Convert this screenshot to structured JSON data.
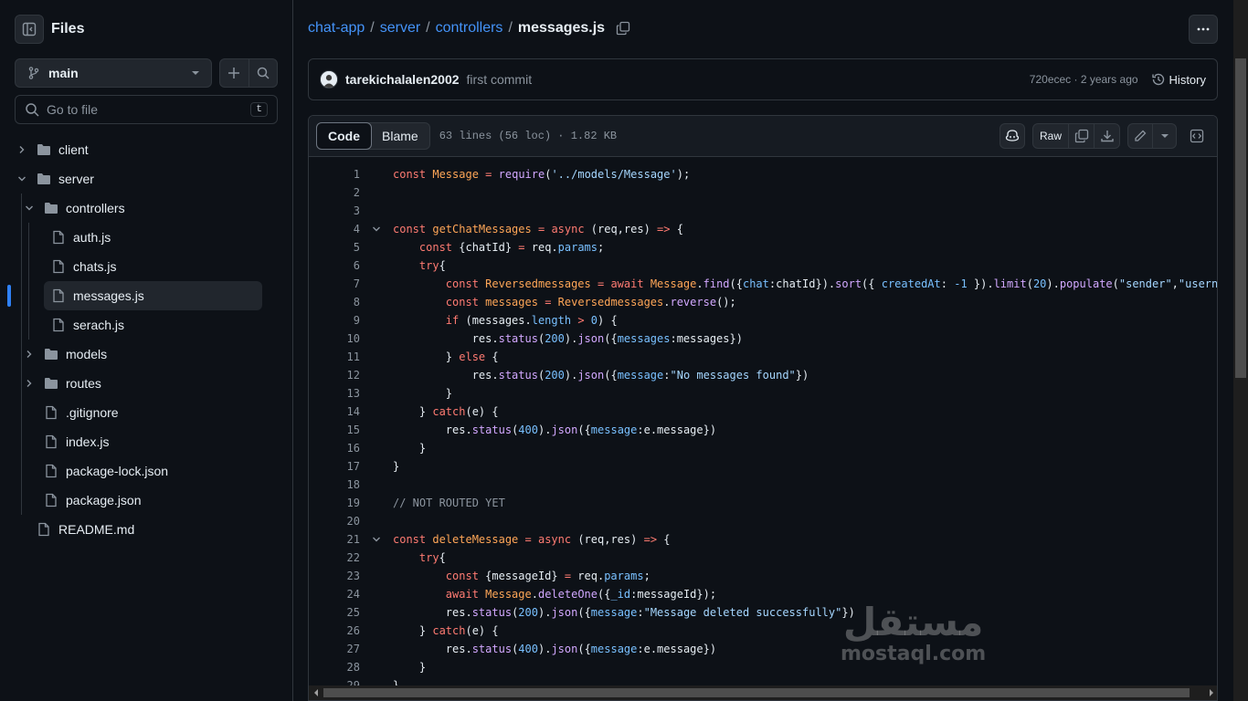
{
  "sidebar": {
    "title": "Files",
    "branch": "main",
    "goto_placeholder": "Go to file",
    "goto_shortcut": "t",
    "tree": [
      {
        "label": "client",
        "type": "folder",
        "depth": 0,
        "expanded": false
      },
      {
        "label": "server",
        "type": "folder",
        "depth": 0,
        "expanded": true
      },
      {
        "label": "controllers",
        "type": "folder",
        "depth": 1,
        "expanded": true
      },
      {
        "label": "auth.js",
        "type": "file",
        "depth": 2
      },
      {
        "label": "chats.js",
        "type": "file",
        "depth": 2
      },
      {
        "label": "messages.js",
        "type": "file",
        "depth": 2,
        "selected": true
      },
      {
        "label": "serach.js",
        "type": "file",
        "depth": 2
      },
      {
        "label": "models",
        "type": "folder",
        "depth": 1,
        "expanded": false
      },
      {
        "label": "routes",
        "type": "folder",
        "depth": 1,
        "expanded": false
      },
      {
        "label": ".gitignore",
        "type": "file",
        "depth": 1
      },
      {
        "label": "index.js",
        "type": "file",
        "depth": 1
      },
      {
        "label": "package-lock.json",
        "type": "file",
        "depth": 1
      },
      {
        "label": "package.json",
        "type": "file",
        "depth": 1
      },
      {
        "label": "README.md",
        "type": "file",
        "depth": 0
      }
    ]
  },
  "breadcrumb": {
    "parts": [
      "chat-app",
      "server",
      "controllers"
    ],
    "current": "messages.js"
  },
  "commit": {
    "author": "tarekichalalen2002",
    "message": "first commit",
    "meta": "720ecec · 2 years ago",
    "history_label": "History"
  },
  "file": {
    "tab_code": "Code",
    "tab_blame": "Blame",
    "info": "63 lines (56 loc) · 1.82 KB",
    "raw_label": "Raw"
  },
  "code_lines": [
    "const Message = require('../models/Message');",
    "",
    "",
    "const getChatMessages = async (req,res) => {",
    "    const {chatId} = req.params;",
    "    try{",
    "        const Reversedmessages = await Message.find({chat:chatId}).sort({ createdAt: -1 }).limit(20).populate(\"sender\",\"username\"",
    "        const messages = Reversedmessages.reverse();",
    "        if (messages.length > 0) {",
    "            res.status(200).json({messages:messages})",
    "        } else {",
    "            res.status(200).json({message:\"No messages found\"})",
    "        }",
    "    } catch(e) {",
    "        res.status(400).json({message:e.message})",
    "    }",
    "}",
    "",
    "// NOT ROUTED YET",
    "",
    "const deleteMessage = async (req,res) => {",
    "    try{",
    "        const {messageId} = req.params;",
    "        await Message.deleteOne({_id:messageId});",
    "        res.status(200).json({message:\"Message deleted successfully\"})",
    "    } catch(e) {",
    "        res.status(400).json({message:e.message})",
    "    }",
    "}"
  ],
  "fold_lines": [
    4,
    21
  ],
  "watermark": {
    "arabic": "مستقل",
    "latin": "mostaql.com"
  }
}
